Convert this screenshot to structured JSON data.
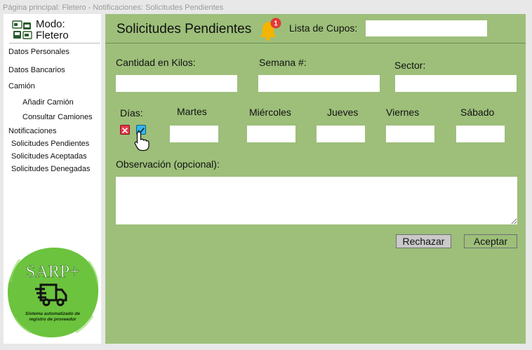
{
  "breadcrumb": "Página principal: Fletero - Notificaciones: Solicitudes Pendientes",
  "sidebar": {
    "mode_label": "Modo:",
    "mode_value": "Fletero",
    "items": [
      {
        "label": "Datos Personales"
      },
      {
        "label": "Datos Bancarios"
      },
      {
        "label": "Camión"
      },
      {
        "label": "Añadir Camión"
      },
      {
        "label": "Consultar Camiones"
      },
      {
        "label": "Notificaciones"
      },
      {
        "label": "Solicitudes Pendientes"
      },
      {
        "label": "Solicitudes Aceptadas"
      },
      {
        "label": "Solicitudes Denegadas"
      }
    ],
    "logo": {
      "name": "SARP+",
      "tagline_line1": "Sistema automatizado de",
      "tagline_line2": "registro de proveedor"
    }
  },
  "header": {
    "title": "Solicitudes Pendientes",
    "notification_count": "1",
    "cupos_label": "Lista de Cupos:",
    "cupos_value": ""
  },
  "form": {
    "kilos_label": "Cantidad en Kilos:",
    "semana_label": "Semana #:",
    "sector_label": "Sector:",
    "kilos_value": "",
    "semana_value": "",
    "sector_value": "",
    "days_label": "Días:",
    "days": [
      {
        "label": "Martes",
        "value": ""
      },
      {
        "label": "Miércoles",
        "value": ""
      },
      {
        "label": "Jueves",
        "value": ""
      },
      {
        "label": "Viernes",
        "value": ""
      },
      {
        "label": "Sábado",
        "value": ""
      }
    ],
    "observation_label": "Observación (opcional):",
    "observation_value": ""
  },
  "actions": {
    "reject_label": "Rechazar",
    "accept_label": "Aceptar"
  },
  "colors": {
    "main_bg": "#9dbf7a",
    "logo_green": "#6cc33e",
    "badge_red": "#e53935",
    "bell_yellow": "#f5b400"
  }
}
